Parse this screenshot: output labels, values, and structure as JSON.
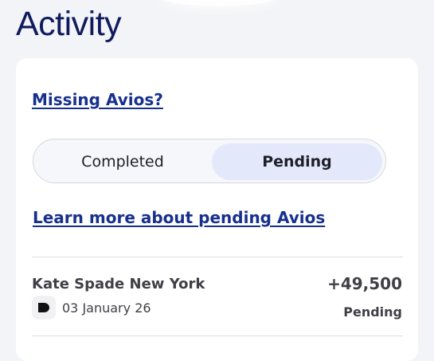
{
  "header": {
    "title": "Activity"
  },
  "card": {
    "missing_link": "Missing Avios?",
    "tabs": [
      {
        "label": "Completed",
        "selected": false
      },
      {
        "label": "Pending",
        "selected": true
      }
    ],
    "learn_link": "Learn more about pending Avios",
    "transactions": [
      {
        "merchant": "Kate Spade New York",
        "date": "03 January 26",
        "amount": "+49,500",
        "status": "Pending",
        "icon": "partner-logo-icon"
      }
    ]
  },
  "colors": {
    "title": "#0f1b5c",
    "link": "#17308c",
    "selected_tab_bg": "#e3e9fb",
    "page_bg": "#f3f4f7"
  }
}
